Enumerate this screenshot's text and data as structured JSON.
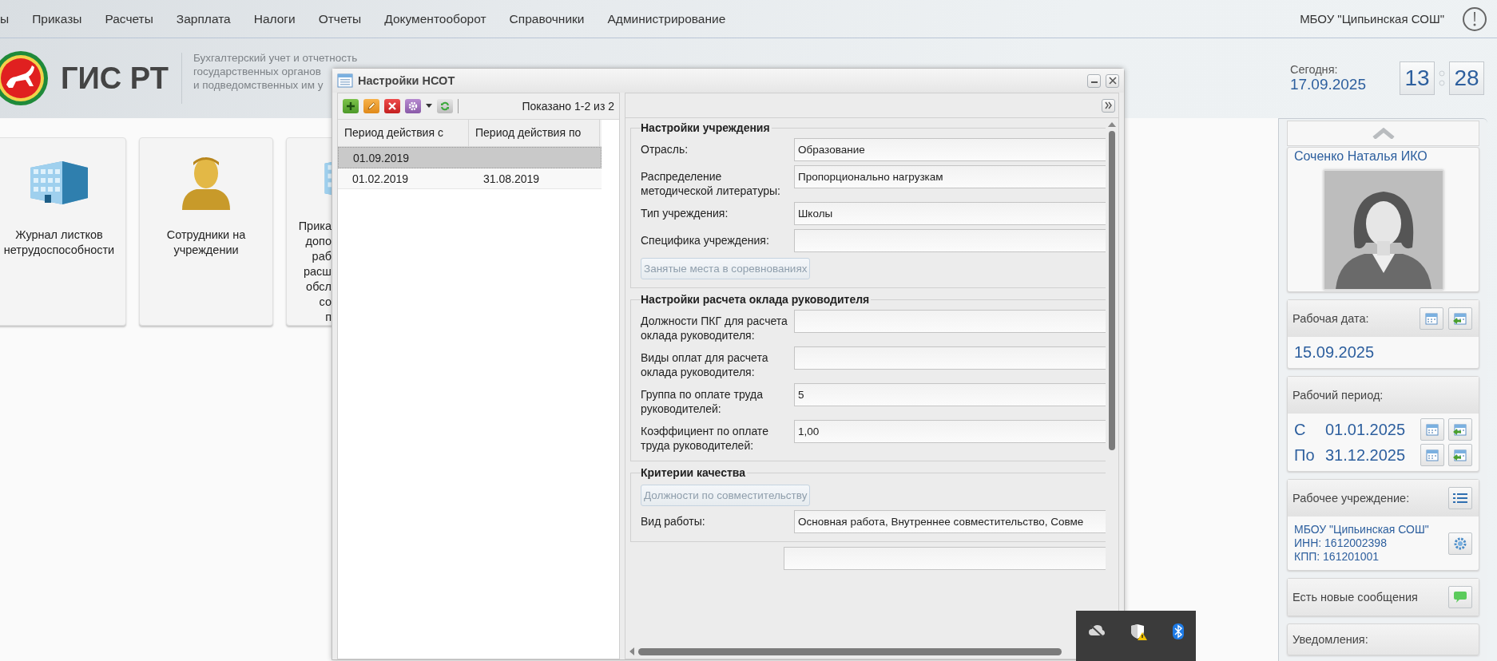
{
  "menu": [
    {
      "label": "ы"
    },
    {
      "label": "Приказы"
    },
    {
      "label": "Расчеты"
    },
    {
      "label": "Зарплата"
    },
    {
      "label": "Налоги"
    },
    {
      "label": "Отчеты"
    },
    {
      "label": "Документооборот"
    },
    {
      "label": "Справочники"
    },
    {
      "label": "Администрирование"
    }
  ],
  "organization": "МБОУ \"Ципьинская СОШ\"",
  "brand": {
    "title": "ГИС РТ",
    "subtitle": [
      "Бухгалтерский учет и отчетность",
      "государственных органов",
      "и подведомственных им у"
    ]
  },
  "today": {
    "label": "Сегодня:",
    "date": "17.09.2025",
    "hours": "13",
    "minutes": "28"
  },
  "tiles": [
    {
      "kind": "building",
      "lines": [
        "Журнал листков",
        "нетрудоспособности"
      ]
    },
    {
      "kind": "person",
      "lines": [
        "Сотрудники на",
        "учреждении"
      ]
    },
    {
      "kind": "building",
      "lines": [
        "Прика",
        "допо",
        "раб",
        "расш",
        "обсл",
        "со",
        "п"
      ]
    }
  ],
  "dialog": {
    "title": "Настройки НСОТ",
    "toolbar": [
      {
        "kind": "add"
      },
      {
        "kind": "edit"
      },
      {
        "kind": "delete"
      },
      {
        "kind": "actions"
      },
      {
        "kind": "refresh"
      }
    ],
    "count": "Показано 1-2 из 2",
    "columns": [
      "Период действия с",
      "Период действия по"
    ],
    "rows": [
      {
        "from": "01.09.2019",
        "selected": true
      },
      {
        "from": "01.02.2019",
        "to": "31.08.2019",
        "selected": false
      }
    ],
    "sections": [
      {
        "title": "Настройки учреждения",
        "items": [
          {
            "kind": "field",
            "label": "Отрасль:",
            "value": "Образование"
          },
          {
            "kind": "field",
            "label": "Распределение методической литературы:",
            "value": "Пропорционально нагрузкам"
          },
          {
            "kind": "field",
            "label": "Тип учреждения:",
            "value": "Школы"
          },
          {
            "kind": "field",
            "label": "Специфика учреждения:"
          },
          {
            "kind": "button",
            "label": "Занятые места в соревнованиях",
            "disabled": true
          }
        ]
      },
      {
        "title": "Настройки расчета оклада руководителя",
        "items": [
          {
            "kind": "field",
            "label": "Должности ПКГ для расчета оклада руководителя:"
          },
          {
            "kind": "field",
            "label": "Виды оплат для расчета оклада руководителя:"
          },
          {
            "kind": "field",
            "label": "Группа по оплате труда руководителей:",
            "value": "5"
          },
          {
            "kind": "field",
            "label": "Коэффициент по оплате труда руководителей:",
            "value": "1,00"
          }
        ]
      },
      {
        "title": "Критерии качества",
        "items": [
          {
            "kind": "button",
            "label": "Должности по совместительству",
            "disabled": true
          },
          {
            "kind": "field",
            "label": "Вид работы:",
            "value": "Основная работа, Внутреннее совместительство, Совме"
          }
        ]
      }
    ]
  },
  "sidebar": {
    "profile": {
      "name": "Соченко Наталья ИКО"
    },
    "work_date": {
      "label": "Рабочая дата:",
      "value": "15.09.2025"
    },
    "work_period": {
      "label": "Рабочий период:",
      "from_label": "С",
      "from": "01.01.2025",
      "to_label": "По",
      "to": "31.12.2025"
    },
    "institution": {
      "label": "Рабочее учреждение:",
      "lines": [
        "МБОУ \"Ципьинская СОШ\"",
        "ИНН: 1612002398",
        "КПП: 161201001"
      ]
    },
    "messages": {
      "label": "Есть новые сообщения"
    },
    "notifications": {
      "label": "Уведомления:"
    }
  },
  "tray": [
    {
      "kind": "cloud-off"
    },
    {
      "kind": "shield-warning"
    },
    {
      "kind": "bluetooth"
    }
  ]
}
